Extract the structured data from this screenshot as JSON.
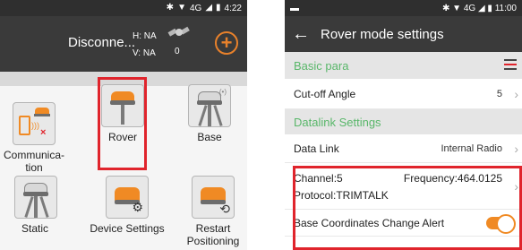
{
  "left": {
    "status_bar": {
      "time": "4:22",
      "network": "4G"
    },
    "header": {
      "connection_status": "Disconne...",
      "h_value": "H: NA",
      "v_value": "V: NA",
      "satellite_count": "0"
    },
    "tiles": [
      {
        "label": "Communica-\ntion",
        "icon": "communication-icon"
      },
      {
        "label": "Rover",
        "icon": "rover-icon"
      },
      {
        "label": "Base",
        "icon": "base-icon"
      },
      {
        "label": "Static",
        "icon": "static-icon"
      },
      {
        "label": "Device Settings",
        "icon": "device-settings-icon"
      },
      {
        "label": "Restart\nPositioning",
        "icon": "restart-positioning-icon"
      }
    ],
    "colors": {
      "accent": "#f08a24",
      "highlight": "#e0242c",
      "header": "#3a3a3a"
    }
  },
  "right": {
    "status_bar": {
      "time": "11:00",
      "network": "4G"
    },
    "header": {
      "title": "Rover mode settings"
    },
    "sections": {
      "basic_para": "Basic para",
      "datalink_settings": "Datalink Settings"
    },
    "cutoff": {
      "label": "Cut-off Angle",
      "value": "5"
    },
    "data_link": {
      "label": "Data Link",
      "value": "Internal Radio"
    },
    "channel": {
      "label": "Channel:5",
      "frequency": "Frequency:464.0125",
      "protocol": "Protocol:TRIMTALK"
    },
    "alert": {
      "label": "Base Coordinates Change Alert",
      "enabled": true
    },
    "colors": {
      "section_text": "#59b76a",
      "toggle": "#f08a24"
    }
  }
}
